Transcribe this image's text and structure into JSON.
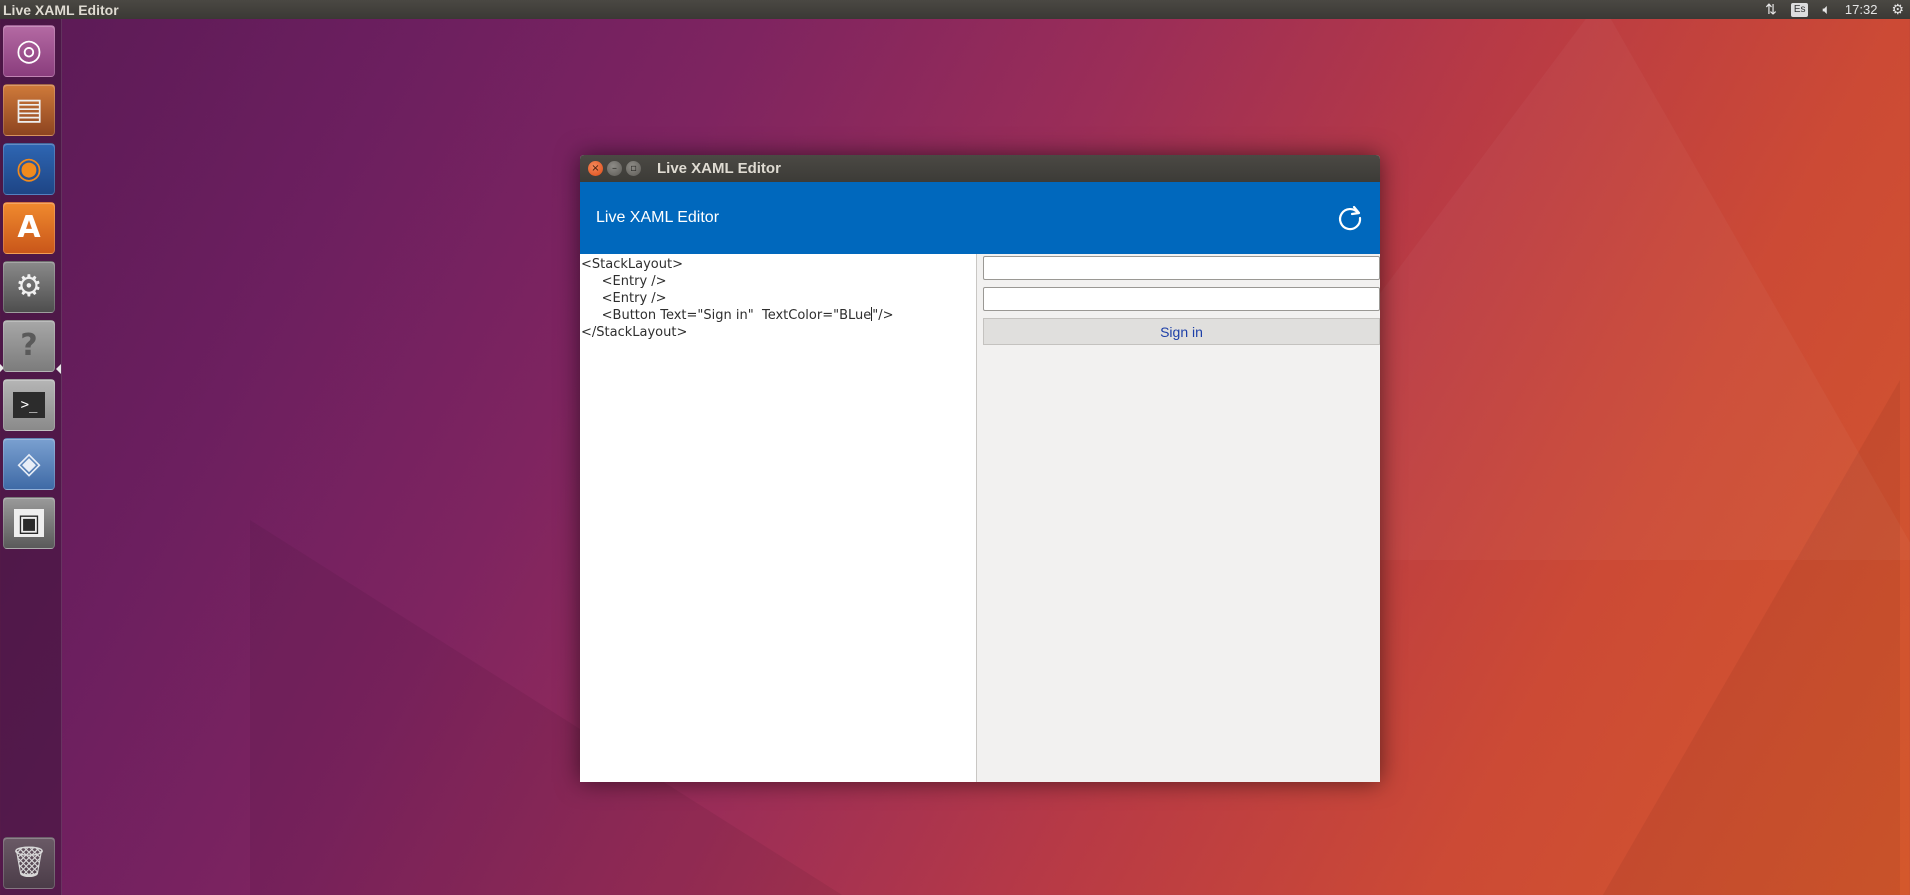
{
  "top_panel": {
    "title": "Live XAML Editor",
    "network_icon": "network-updown-icon",
    "keyboard_layout": "Es",
    "volume_icon": "speaker-icon",
    "time": "17:32",
    "settings_icon": "gear-icon"
  },
  "launcher": {
    "items": [
      {
        "name": "ubuntu-dash",
        "icon": "ubuntu-logo-icon",
        "glyph": "◎",
        "color": "#9c4a8d"
      },
      {
        "name": "files",
        "icon": "file-cabinet-icon",
        "glyph": "▤",
        "color": "#b45a2a"
      },
      {
        "name": "firefox",
        "icon": "firefox-icon",
        "glyph": "◉",
        "color": "#e8731b"
      },
      {
        "name": "software-center",
        "icon": "shopping-bag-icon",
        "glyph": "A",
        "color": "#e06a1f"
      },
      {
        "name": "system-settings",
        "icon": "tools-icon",
        "glyph": "⚙",
        "color": "#5a5a5a"
      },
      {
        "name": "help",
        "icon": "question-icon",
        "glyph": "?",
        "color": "#7d7d7d"
      },
      {
        "name": "terminal",
        "icon": "terminal-icon",
        "glyph": ">_",
        "color": "#2a2a2a"
      },
      {
        "name": "monodevelop",
        "icon": "monodevelop-icon",
        "glyph": "◈",
        "color": "#3d6ea8"
      },
      {
        "name": "save",
        "icon": "floppy-icon",
        "glyph": "▣",
        "color": "#3e3e3e"
      }
    ],
    "trash_icon": "trash-icon"
  },
  "window": {
    "title": "Live XAML Editor",
    "appbar_title": "Live XAML Editor",
    "refresh_icon": "refresh-icon",
    "accent": "#0068bd"
  },
  "editor": {
    "lines": [
      "<StackLayout>",
      "     <Entry />",
      "     <Entry />",
      "     <Button Text=\"Sign in\"  TextColor=\"BLue",
      "</StackLayout>"
    ],
    "caret_line_suffix": "\"/>"
  },
  "preview": {
    "entries": [
      "",
      ""
    ],
    "button_label": "Sign in",
    "button_text_color": "#1d3fa8"
  }
}
